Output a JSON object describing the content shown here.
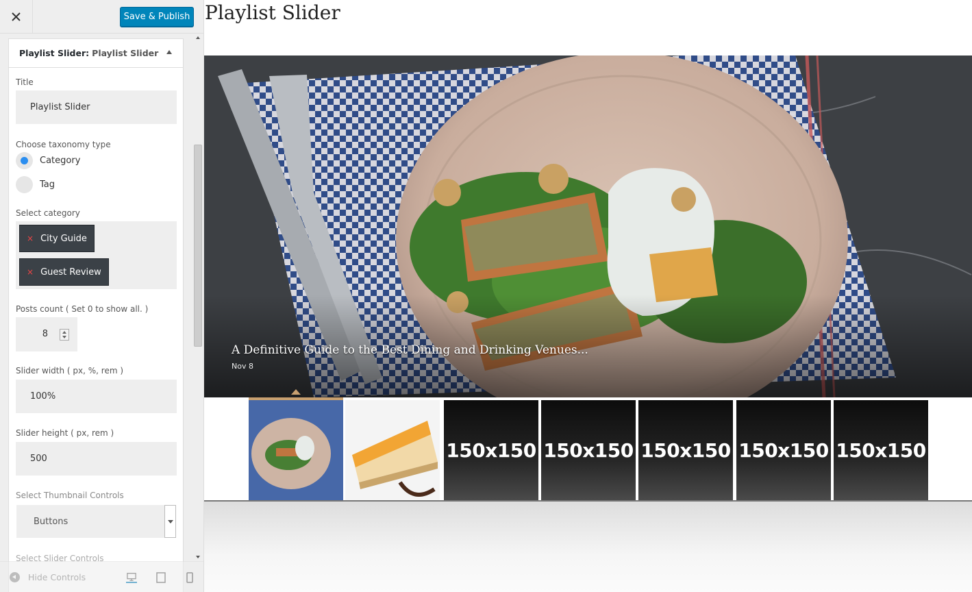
{
  "header": {
    "close_icon": "close-icon",
    "publish_label": "Save & Publish",
    "publish_color": "#0085ba"
  },
  "section": {
    "widget_type": "Playlist Slider:",
    "widget_name": "Playlist Slider"
  },
  "form": {
    "title_label": "Title",
    "title_value": "Playlist Slider",
    "taxonomy_label": "Choose taxonomy type",
    "taxonomy_options": [
      "Category",
      "Tag"
    ],
    "taxonomy_selected": "Category",
    "category_label": "Select category",
    "categories": [
      "City Guide",
      "Guest Review"
    ],
    "posts_count_label": "Posts count ( Set 0 to show all. )",
    "posts_count_value": "8",
    "slider_width_label": "Slider width ( px, %, rem )",
    "slider_width_value": "100%",
    "slider_height_label": "Slider height ( px, rem )",
    "slider_height_value": "500",
    "thumb_controls_label": "Select Thumbnail Controls",
    "thumb_controls_value": "Buttons",
    "slider_controls_label": "Select Slider Controls"
  },
  "footer": {
    "hide_controls_label": "Hide Controls",
    "devices": [
      "desktop-icon",
      "tablet-icon",
      "mobile-icon"
    ]
  },
  "preview": {
    "title": "Playlist Slider",
    "slide_caption": "A Definitive Guide to the Best Dining and Drinking Venues...",
    "slide_date": "Nov 8",
    "thumbnails": [
      "food-plate-thumbnail",
      "cheesecake-thumbnail",
      "150x150",
      "150x150",
      "150x150",
      "150x150",
      "150x150"
    ],
    "accent_color": "#c8a070"
  }
}
